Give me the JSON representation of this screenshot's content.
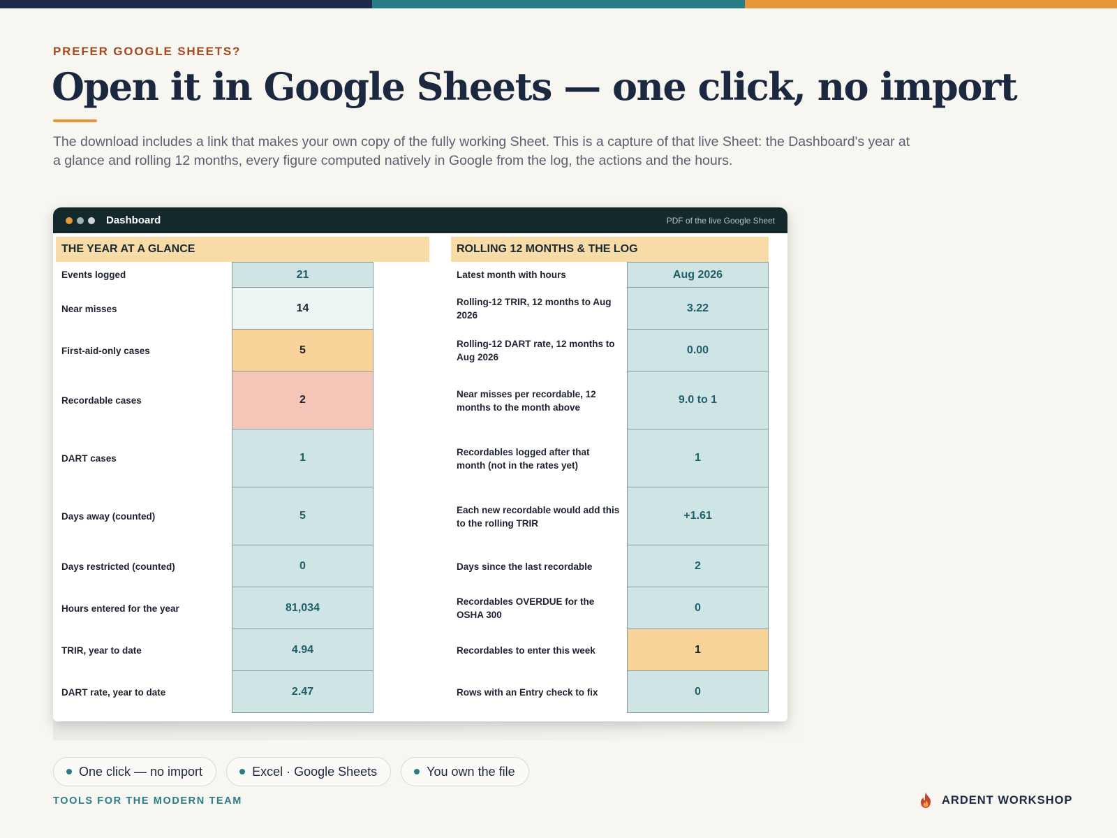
{
  "colors": {
    "topbar": [
      "#1c2a4a",
      "#2a7d86",
      "#e8963c"
    ],
    "accent": "#e8963c",
    "teal": "#2a7d86",
    "value_default": "#cfe5e5",
    "value_light": "#ecf4f4",
    "value_amber": "#f8d49a",
    "value_salmon": "#f5c6b8"
  },
  "header": {
    "eyebrow": "PREFER GOOGLE SHEETS?",
    "title": "Open it in Google Sheets — one click, no import",
    "intro": "The download includes a link that makes your own copy of the fully working Sheet. This is a capture of that live Sheet: the Dashboard's year at a glance and rolling 12 months, every figure computed natively in Google from the log, the actions and the hours."
  },
  "window": {
    "title": "Dashboard",
    "note": "PDF of the live Google Sheet",
    "dots": [
      "#e8963c",
      "#9fb4b7",
      "#cfd9da"
    ]
  },
  "year_panel": {
    "heading": "THE YEAR AT A GLANCE",
    "rows": [
      {
        "label": "Events logged",
        "value": "21",
        "tone": "default"
      },
      {
        "label": "Near misses",
        "value": "14",
        "tone": "light"
      },
      {
        "label": "First-aid-only cases",
        "value": "5",
        "tone": "amber"
      },
      {
        "label": "Recordable cases",
        "value": "2",
        "tone": "salmon"
      },
      {
        "label": "DART cases",
        "value": "1",
        "tone": "default"
      },
      {
        "label": "Days away (counted)",
        "value": "5",
        "tone": "default"
      },
      {
        "label": "Days restricted (counted)",
        "value": "0",
        "tone": "default"
      },
      {
        "label": "Hours entered for the year",
        "value": "81,034",
        "tone": "default"
      },
      {
        "label": "TRIR, year to date",
        "value": "4.94",
        "tone": "default"
      },
      {
        "label": "DART rate, year to date",
        "value": "2.47",
        "tone": "default"
      }
    ]
  },
  "rolling_panel": {
    "heading": "ROLLING 12 MONTHS & THE LOG",
    "rows": [
      {
        "label": "Latest month with hours",
        "value": "Aug 2026",
        "tone": "default"
      },
      {
        "label": "Rolling-12 TRIR, 12 months to Aug 2026",
        "value": "3.22",
        "tone": "default"
      },
      {
        "label": "Rolling-12 DART rate, 12 months to Aug 2026",
        "value": "0.00",
        "tone": "default"
      },
      {
        "label": "Near misses per recordable, 12 months to the month above",
        "value": "9.0 to 1",
        "tone": "default"
      },
      {
        "label": "Recordables logged after that month (not in the rates yet)",
        "value": "1",
        "tone": "default"
      },
      {
        "label": "Each new recordable would add this to the rolling TRIR",
        "value": "+1.61",
        "tone": "default"
      },
      {
        "label": "Days since the last recordable",
        "value": "2",
        "tone": "default"
      },
      {
        "label": "Recordables OVERDUE for the OSHA 300",
        "value": "0",
        "tone": "default"
      },
      {
        "label": "Recordables to enter this week",
        "value": "1",
        "tone": "amber"
      },
      {
        "label": "Rows with an Entry check to fix",
        "value": "0",
        "tone": "default"
      }
    ]
  },
  "chips": [
    "One click — no import",
    "Excel · Google Sheets",
    "You own the file"
  ],
  "footer": {
    "tagline": "TOOLS FOR THE MODERN TEAM",
    "brand": "ARDENT WORKSHOP",
    "brand_icon": "flame-icon"
  }
}
